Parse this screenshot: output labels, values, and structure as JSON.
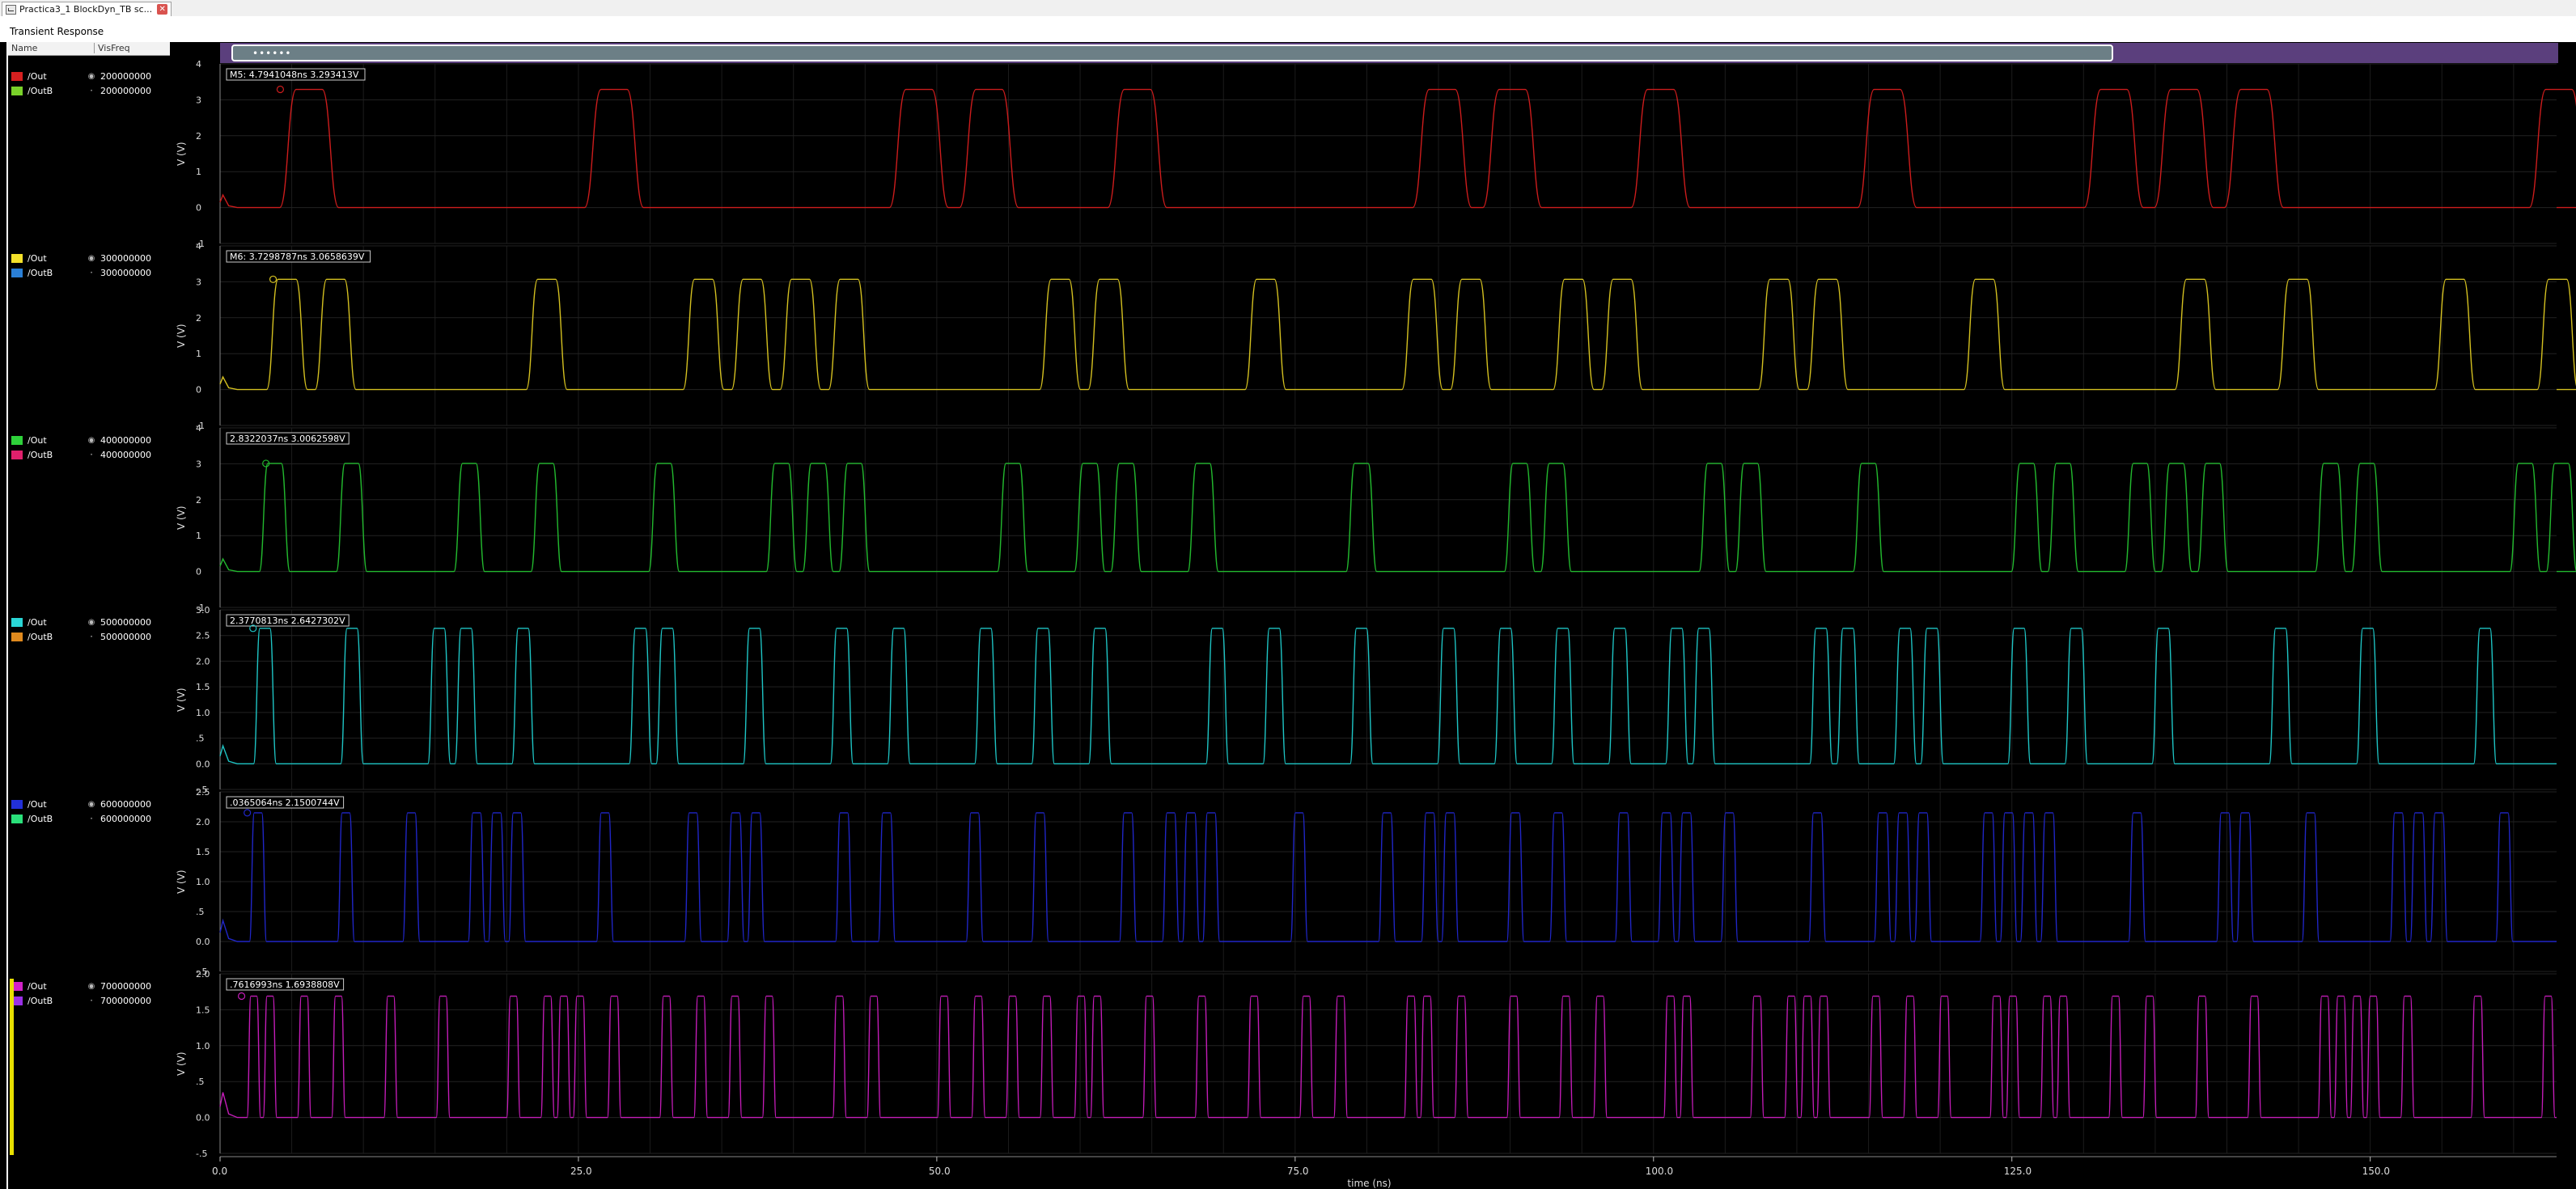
{
  "tab": {
    "title": "Practica3_1 BlockDyn_TB sc...",
    "close_label": "✕"
  },
  "window_title": "Transient Response",
  "legend_header": {
    "name": "Name",
    "vis_freq": "VisFreq"
  },
  "plots": [
    {
      "signals": [
        {
          "name": "/Out",
          "freq": "200000000",
          "color": "#d62020"
        },
        {
          "name": "/OutB",
          "freq": "200000000",
          "color": "#7ad22a"
        }
      ],
      "marker": "M5: 4.7941048ns 3.293413V",
      "yticks": [
        "4",
        "3",
        "2",
        "1",
        "0",
        "-1"
      ],
      "ylabel": "V (V)",
      "trace_color": "#cc1c1c"
    },
    {
      "signals": [
        {
          "name": "/Out",
          "freq": "300000000",
          "color": "#f4e12a"
        },
        {
          "name": "/OutB",
          "freq": "300000000",
          "color": "#2a7fd6"
        }
      ],
      "marker": "M6: 3.7298787ns 3.0658639V",
      "yticks": [
        "4",
        "3",
        "2",
        "1",
        "0",
        "-1"
      ],
      "ylabel": "V (V)",
      "trace_color": "#d4c020"
    },
    {
      "signals": [
        {
          "name": "/Out",
          "freq": "400000000",
          "color": "#2ed13a"
        },
        {
          "name": "/OutB",
          "freq": "400000000",
          "color": "#e0206c"
        }
      ],
      "marker": "2.8322037ns 3.0062598V",
      "yticks": [
        "4",
        "3",
        "2",
        "1",
        "0",
        "-1"
      ],
      "ylabel": "V (V)",
      "trace_color": "#22b82e"
    },
    {
      "signals": [
        {
          "name": "/Out",
          "freq": "500000000",
          "color": "#2ad6d6"
        },
        {
          "name": "/OutB",
          "freq": "500000000",
          "color": "#e08a1e"
        }
      ],
      "marker": "2.3770813ns 2.6427302V",
      "yticks": [
        "3.0",
        "2.5",
        "2.0",
        "1.5",
        "1.0",
        ".5",
        "0.0",
        "-.5"
      ],
      "ylabel": "V (V)",
      "trace_color": "#1ec4c4"
    },
    {
      "signals": [
        {
          "name": "/Out",
          "freq": "600000000",
          "color": "#2230d8"
        },
        {
          "name": "/OutB",
          "freq": "600000000",
          "color": "#2ae07a"
        }
      ],
      "marker": ".0365064ns 2.1500744V",
      "yticks": [
        "2.5",
        "2.0",
        "1.5",
        "1.0",
        ".5",
        "0.0",
        "-.5"
      ],
      "ylabel": "V (V)",
      "trace_color": "#2026c8"
    },
    {
      "signals": [
        {
          "name": "/Out",
          "freq": "700000000",
          "color": "#d222c8"
        },
        {
          "name": "/OutB",
          "freq": "700000000",
          "color": "#9a30e6"
        }
      ],
      "marker": ".7616993ns 1.6938808V",
      "yticks": [
        "2.0",
        "1.5",
        "1.0",
        ".5",
        "0.0",
        "-.5"
      ],
      "ylabel": "V (V)",
      "trace_color": "#c41cb8"
    }
  ],
  "xaxis": {
    "ticks": [
      "0.0",
      "25.0",
      "50.0",
      "75.0",
      "100.0",
      "125.0",
      "150.0"
    ],
    "label": "time (ns)"
  },
  "icons": {
    "visible": "eye-icon",
    "hidden": "dot-icon"
  }
}
